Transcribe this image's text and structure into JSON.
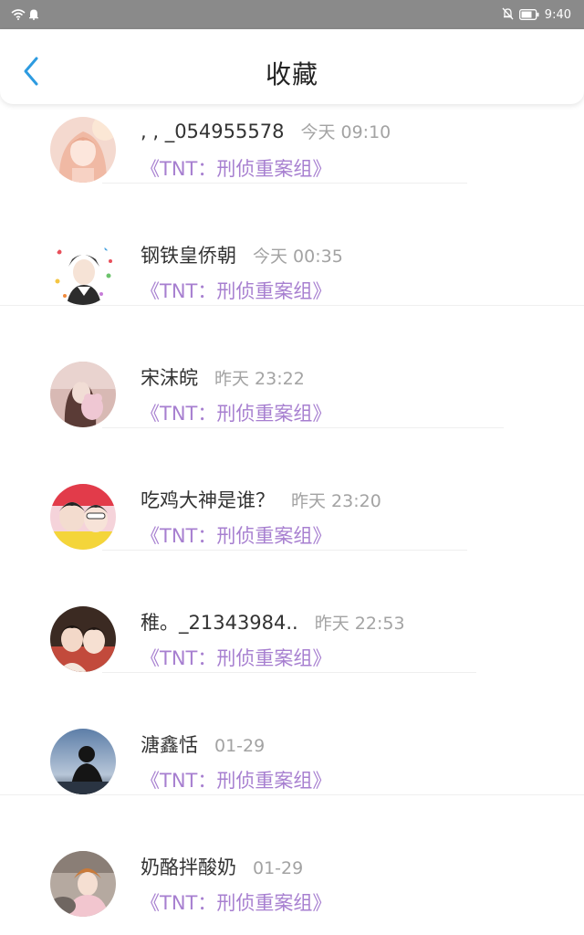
{
  "status_bar": {
    "time": "9:40",
    "icons": [
      "wifi-icon",
      "notification-bell-icon",
      "mute-icon",
      "battery-icon"
    ]
  },
  "header": {
    "title": "收藏",
    "back_icon": "chevron-left-icon"
  },
  "colors": {
    "status_bar": "#8a8a8a",
    "back_arrow": "#2d9be0",
    "link": "#a77fd0",
    "timestamp": "#a3a3a3"
  },
  "items": [
    {
      "name": ", , _054955578",
      "time": "今天 09:10",
      "link": "《TNT：刑侦重案组》"
    },
    {
      "name": "钢铁皇侨朝",
      "time": "今天 00:35",
      "link": "《TNT：刑侦重案组》"
    },
    {
      "name": "宋沫皖",
      "time": "昨天 23:22",
      "link": "《TNT：刑侦重案组》"
    },
    {
      "name": "吃鸡大神是谁？",
      "time": "昨天 23:20",
      "link": "《TNT：刑侦重案组》"
    },
    {
      "name": "稚。_21343984..",
      "time": "昨天 22:53",
      "link": "《TNT：刑侦重案组》"
    },
    {
      "name": "溏鑫恬",
      "time": "01-29",
      "link": "《TNT：刑侦重案组》"
    },
    {
      "name": "奶酪拌酸奶",
      "time": "01-29",
      "link": "《TNT：刑侦重案组》"
    }
  ]
}
